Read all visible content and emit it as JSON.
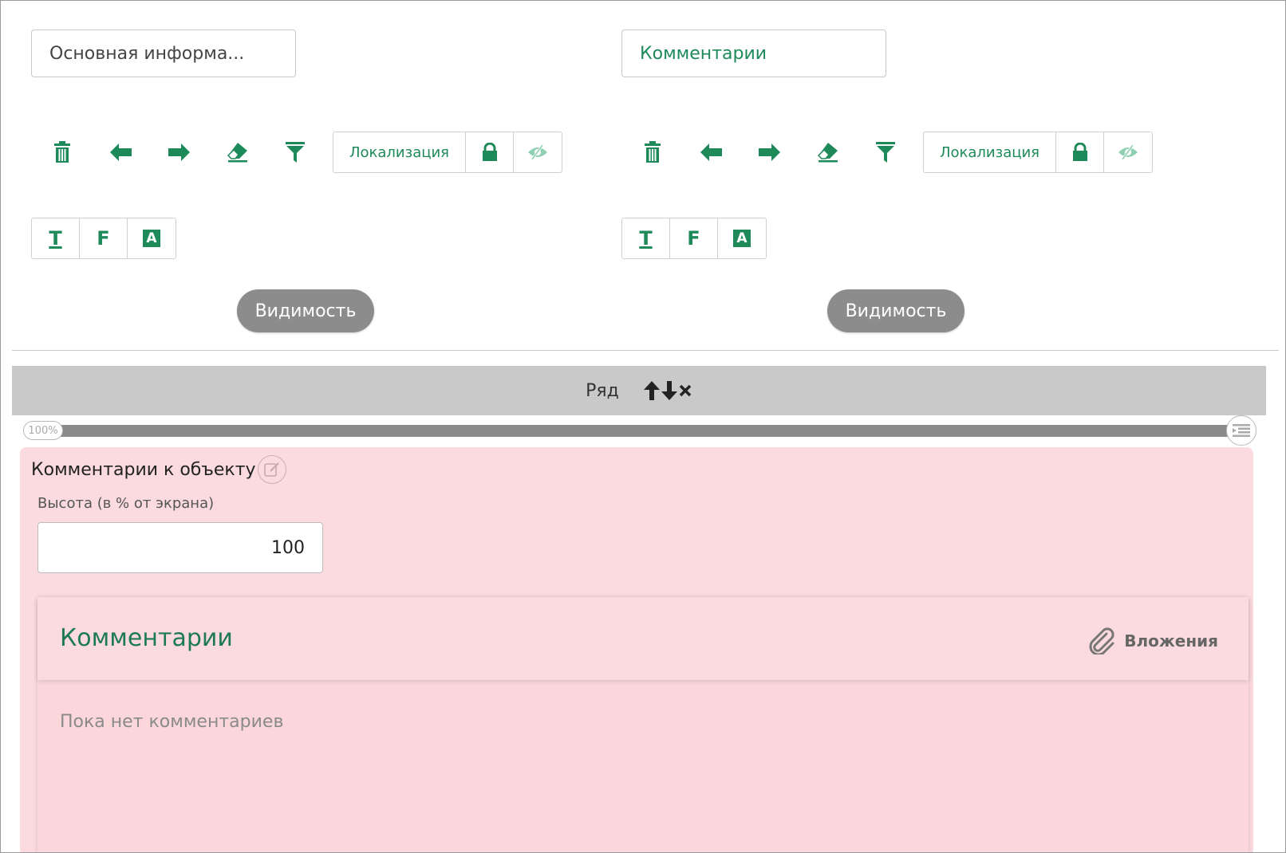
{
  "colors": {
    "accent": "#1e8a5a",
    "pill": "#8c8c8c",
    "rowbar": "#c9c9c9",
    "pink": "#fcdbe0"
  },
  "panels": [
    {
      "tab_label": "Основная информа...",
      "toolbar": {
        "icons": [
          "trash-icon",
          "arrow-left-icon",
          "arrow-right-icon",
          "eraser-icon",
          "filter-icon"
        ],
        "localization_label": "Локализация",
        "lock_icon": "lock-icon",
        "visibility_icon": "eye-slash-icon"
      },
      "format_buttons": [
        "Т",
        "F",
        "A"
      ],
      "visibility_label": "Видимость"
    },
    {
      "tab_label": "Комментарии",
      "toolbar": {
        "icons": [
          "trash-icon",
          "arrow-left-icon",
          "arrow-right-icon",
          "eraser-icon",
          "filter-icon"
        ],
        "localization_label": "Локализация",
        "lock_icon": "lock-icon",
        "visibility_icon": "eye-slash-icon"
      },
      "format_buttons": [
        "Т",
        "F",
        "A"
      ],
      "visibility_label": "Видимость"
    }
  ],
  "row": {
    "label": "Ряд",
    "width_percent": "100%"
  },
  "component": {
    "title": "Комментарии к объекту",
    "height_label": "Высота (в % от экрана)",
    "height_value": "100",
    "card_title": "Комментарии",
    "attachments_label": "Вложения",
    "empty_text": "Пока нет комментариев"
  }
}
